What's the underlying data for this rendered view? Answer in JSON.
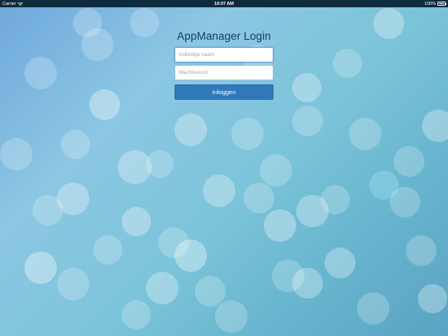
{
  "statusbar": {
    "carrier": "Carrier",
    "time": "10:07 AM",
    "battery": "100%"
  },
  "login": {
    "title": "AppManager Login",
    "name_placeholder": "Volledige naam",
    "password_placeholder": "Wachtwoord",
    "button_label": "Inloggen"
  },
  "colors": {
    "statusbar_bg": "#0f2c3e",
    "title": "#143d64",
    "button_bg": "#2f79b8"
  },
  "icons": {
    "wifi": "wifi-icon",
    "battery": "battery-icon"
  }
}
